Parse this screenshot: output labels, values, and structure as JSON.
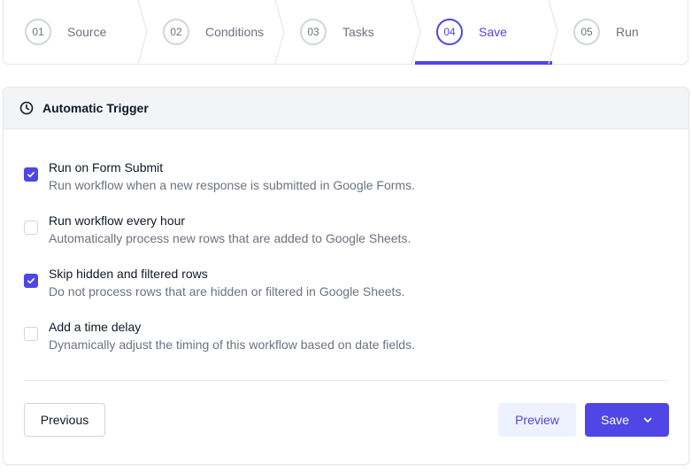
{
  "stepper": {
    "steps": [
      {
        "num": "01",
        "label": "Source"
      },
      {
        "num": "02",
        "label": "Conditions"
      },
      {
        "num": "03",
        "label": "Tasks"
      },
      {
        "num": "04",
        "label": "Save"
      },
      {
        "num": "05",
        "label": "Run"
      }
    ],
    "active_index": 3
  },
  "card": {
    "title": "Automatic Trigger",
    "icon": "clock-icon",
    "options": [
      {
        "title": "Run on Form Submit",
        "desc": "Run workflow when a new response is submitted in Google Forms.",
        "checked": true
      },
      {
        "title": "Run workflow every hour",
        "desc": "Automatically process new rows that are added to Google Sheets.",
        "checked": false
      },
      {
        "title": "Skip hidden and filtered rows",
        "desc": "Do not process rows that are hidden or filtered in Google Sheets.",
        "checked": true
      },
      {
        "title": "Add a time delay",
        "desc": "Dynamically adjust the timing of this workflow based on date fields.",
        "checked": false
      }
    ]
  },
  "footer": {
    "previous_label": "Previous",
    "preview_label": "Preview",
    "save_label": "Save"
  },
  "colors": {
    "accent": "#4f46e5",
    "accent_light": "#eef2ff",
    "border": "#e5e7eb",
    "muted_text": "#6b7280"
  }
}
